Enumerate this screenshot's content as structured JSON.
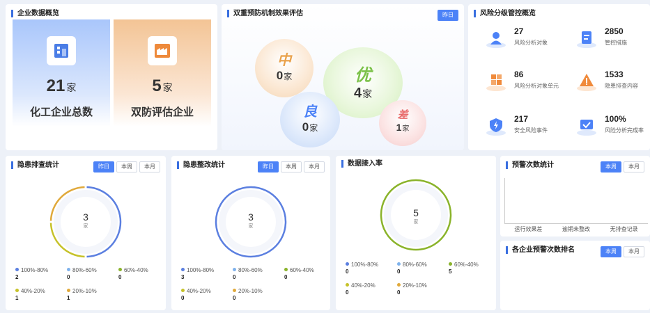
{
  "overview": {
    "title": "企业数据概览",
    "chem": {
      "value": "21",
      "unit": "家",
      "label": "化工企业总数"
    },
    "dual": {
      "value": "5",
      "unit": "家",
      "label": "双防评估企业"
    }
  },
  "eval": {
    "title": "双重预防机制效果评估",
    "tab": "昨日",
    "zhong": {
      "grade": "中",
      "value": "0",
      "unit": "家"
    },
    "you": {
      "grade": "优",
      "value": "4",
      "unit": "家"
    },
    "liang": {
      "grade": "良",
      "value": "0",
      "unit": "家"
    },
    "cha": {
      "grade": "差",
      "value": "1",
      "unit": "家"
    }
  },
  "risk": {
    "title": "风险分级管控概览",
    "items": [
      {
        "value": "27",
        "label": "风险分析对象",
        "icon": "user-icon"
      },
      {
        "value": "2850",
        "label": "管控措施",
        "icon": "document-icon"
      },
      {
        "value": "86",
        "label": "风险分析对象单元",
        "icon": "grid-icon"
      },
      {
        "value": "1533",
        "label": "隐患排查内容",
        "icon": "warning-icon"
      },
      {
        "value": "217",
        "label": "安全风险事件",
        "icon": "shield-icon"
      },
      {
        "value": "100%",
        "label": "风险分析完成率",
        "icon": "check-icon"
      }
    ]
  },
  "hazard_check": {
    "title": "隐患排查统计",
    "tabs": [
      "昨日",
      "本周",
      "本月"
    ],
    "total": "3",
    "unit": "家",
    "legend": [
      {
        "label": "100%-80%",
        "value": "2",
        "color": "#5b7fe0"
      },
      {
        "label": "80%-60%",
        "value": "0",
        "color": "#7fb2ec"
      },
      {
        "label": "60%-40%",
        "value": "0",
        "color": "#8ab32a"
      },
      {
        "label": "40%-20%",
        "value": "1",
        "color": "#c6c229"
      },
      {
        "label": "20%-10%",
        "value": "1",
        "color": "#e0a93b"
      }
    ]
  },
  "hazard_fix": {
    "title": "隐患整改统计",
    "tabs": [
      "昨日",
      "本周",
      "本月"
    ],
    "total": "3",
    "unit": "家",
    "legend": [
      {
        "label": "100%-80%",
        "value": "3",
        "color": "#5b7fe0"
      },
      {
        "label": "80%-60%",
        "value": "0",
        "color": "#7fb2ec"
      },
      {
        "label": "60%-40%",
        "value": "0",
        "color": "#8ab32a"
      },
      {
        "label": "40%-20%",
        "value": "0",
        "color": "#c6c229"
      },
      {
        "label": "20%-10%",
        "value": "0",
        "color": "#e0a93b"
      }
    ]
  },
  "access": {
    "title": "数据接入率",
    "total": "5",
    "unit": "家",
    "legend": [
      {
        "label": "100%-80%",
        "value": "0",
        "color": "#5b7fe0"
      },
      {
        "label": "80%-60%",
        "value": "0",
        "color": "#7fb2ec"
      },
      {
        "label": "60%-40%",
        "value": "5",
        "color": "#8ab32a"
      },
      {
        "label": "40%-20%",
        "value": "0",
        "color": "#c6c229"
      },
      {
        "label": "20%-10%",
        "value": "0",
        "color": "#e0a93b"
      }
    ]
  },
  "warn_count": {
    "title": "预警次数统计",
    "tabs": [
      "本周",
      "本月"
    ],
    "categories": [
      "运行效果差",
      "逾期未整改",
      "无排查记录"
    ]
  },
  "warn_rank": {
    "title": "各企业预警次数排名",
    "tabs": [
      "本周",
      "本月"
    ]
  },
  "chart_data": [
    {
      "type": "pie",
      "title": "隐患排查统计",
      "categories": [
        "100%-80%",
        "80%-60%",
        "60%-40%",
        "40%-20%",
        "20%-10%"
      ],
      "values": [
        2,
        0,
        0,
        1,
        1
      ]
    },
    {
      "type": "pie",
      "title": "隐患整改统计",
      "categories": [
        "100%-80%",
        "80%-60%",
        "60%-40%",
        "40%-20%",
        "20%-10%"
      ],
      "values": [
        3,
        0,
        0,
        0,
        0
      ]
    },
    {
      "type": "pie",
      "title": "数据接入率",
      "categories": [
        "100%-80%",
        "80%-60%",
        "60%-40%",
        "40%-20%",
        "20%-10%"
      ],
      "values": [
        0,
        0,
        5,
        0,
        0
      ]
    }
  ]
}
